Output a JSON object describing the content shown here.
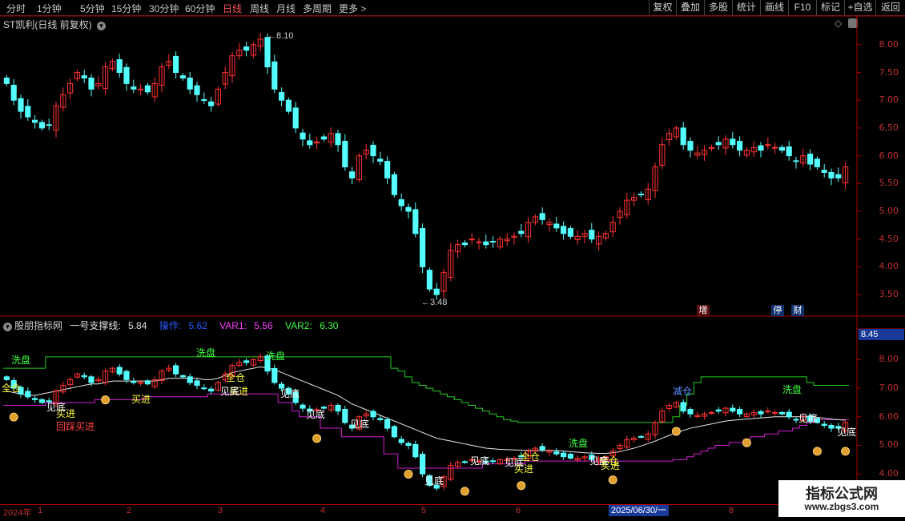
{
  "toolbar": {
    "periods": [
      "分时",
      "1分钟",
      "5分钟",
      "15分钟",
      "30分钟",
      "60分钟",
      "日线",
      "周线",
      "月线",
      "多周期",
      "更多 >"
    ],
    "active_period": "日线",
    "buttons": [
      "复权",
      "叠加",
      "多股",
      "统计",
      "画线",
      "F10",
      "标记",
      "+自选",
      "返回"
    ]
  },
  "main_chart": {
    "title": "ST凯利(日线 前复权)",
    "high_label": "8.10",
    "low_label": "3.48",
    "y_ticks": [
      "8.00",
      "7.50",
      "7.00",
      "6.50",
      "6.00",
      "5.50",
      "5.00",
      "4.50",
      "4.00",
      "3.50"
    ],
    "events": [
      {
        "text": "增",
        "color": "#c02020"
      },
      {
        "text": "停",
        "color": "#2060c0"
      },
      {
        "text": "财",
        "color": "#2060c0"
      }
    ]
  },
  "indicator": {
    "name": "股朋指标网",
    "fields": [
      {
        "label": "一号支撑线:",
        "value": "5.84",
        "color": "#e0e0e0"
      },
      {
        "label": "操作:",
        "value": "5.62",
        "color": "#2a5cff"
      },
      {
        "label": "VAR1:",
        "value": "5.56",
        "color": "#ff40ff"
      },
      {
        "label": "VAR2:",
        "value": "6.30",
        "color": "#40ff40"
      }
    ],
    "current_price": "8.45",
    "y_ticks": [
      "8.00",
      "7.00",
      "6.00",
      "5.00",
      "4.00"
    ],
    "signals": {
      "wash": "洗盘",
      "full": "全仓",
      "reduce": "减仓",
      "buy": "买进",
      "bottom": "见底",
      "pullback_buy": "回踩买进"
    }
  },
  "time_axis": {
    "labels": [
      "2024年",
      "1",
      "2",
      "3",
      "4",
      "5",
      "6",
      "2025/06/30/一",
      "8"
    ],
    "cursor_date": "2025/06/30/一"
  },
  "watermark": {
    "title": "指标公式网",
    "url": "www.zbgs3.com"
  },
  "chart_data": {
    "type": "candlestick",
    "ylim_main": [
      3.3,
      8.3
    ],
    "ylim_indicator": [
      3.5,
      8.6
    ],
    "closes": [
      7.3,
      7.0,
      6.8,
      6.7,
      6.6,
      6.5,
      6.55,
      6.9,
      7.1,
      7.3,
      7.5,
      7.4,
      7.2,
      7.3,
      7.6,
      7.7,
      7.5,
      7.3,
      7.2,
      7.2,
      7.15,
      7.3,
      7.6,
      7.7,
      7.5,
      7.4,
      7.2,
      7.1,
      7.0,
      6.9,
      7.2,
      7.5,
      7.8,
      7.9,
      7.9,
      8.0,
      8.1,
      7.6,
      7.2,
      7.0,
      6.8,
      6.5,
      6.3,
      6.2,
      6.25,
      6.3,
      6.4,
      6.2,
      5.8,
      5.6,
      6.0,
      6.1,
      6.0,
      5.9,
      5.6,
      5.3,
      5.1,
      5.0,
      4.6,
      4.0,
      3.6,
      3.5,
      3.9,
      4.3,
      4.4,
      4.4,
      4.5,
      4.45,
      4.4,
      4.45,
      4.5,
      4.5,
      4.55,
      4.6,
      4.8,
      4.9,
      4.85,
      4.8,
      4.7,
      4.6,
      4.55,
      4.55,
      4.6,
      4.5,
      4.55,
      4.6,
      4.8,
      5.0,
      5.2,
      5.25,
      5.3,
      5.4,
      5.8,
      6.2,
      6.4,
      6.5,
      6.2,
      6.1,
      6.05,
      6.1,
      6.15,
      6.2,
      6.3,
      6.2,
      6.1,
      6.1,
      6.15,
      6.1,
      6.2,
      6.15,
      6.1,
      6.0,
      5.9,
      6.0,
      5.85,
      5.8,
      5.7,
      5.6,
      5.6,
      5.8
    ],
    "support_line": [
      6.9,
      6.9,
      6.9,
      6.9,
      6.9,
      6.9,
      7.3,
      7.3,
      7.3,
      7.3,
      7.3,
      7.3,
      7.3,
      7.3,
      7.3,
      7.3,
      7.3,
      7.3,
      7.3,
      7.3,
      7.3,
      7.3,
      7.3,
      7.3,
      7.3,
      7.3,
      7.3,
      7.3,
      7.3,
      7.3,
      7.3,
      7.3,
      7.3,
      7.3,
      7.3,
      7.3,
      7.3,
      7.3,
      7.3,
      7.3,
      7.3,
      7.3,
      7.3,
      7.3,
      7.3,
      7.3,
      7.3,
      7.3,
      7.3,
      7.3,
      7.3,
      7.3,
      7.3,
      7.3,
      7.3,
      6.9,
      6.8,
      6.6,
      6.4,
      6.3,
      6.2,
      6.1,
      6.0,
      5.9,
      5.8,
      5.7,
      5.6,
      5.5,
      5.4,
      5.3,
      5.2,
      5.1,
      5.05,
      5.0,
      5.0,
      5.0,
      5.0,
      5.0,
      5.0,
      5.0,
      5.0,
      5.0,
      5.0,
      5.0,
      5.0,
      5.0,
      5.0,
      5.0,
      5.0,
      5.0,
      5.0,
      5.0,
      5.0,
      5.0,
      5.0,
      5.2,
      5.6,
      6.0,
      6.4,
      6.6,
      6.6,
      6.6,
      6.6,
      6.6,
      6.6,
      6.6,
      6.6,
      6.6,
      6.6,
      6.6,
      6.6,
      6.6,
      6.6,
      6.6,
      6.4,
      6.3,
      6.3,
      6.3,
      6.3,
      6.3
    ],
    "trend_line": [
      6.9,
      6.85,
      6.8,
      6.75,
      6.75,
      6.8,
      6.85,
      6.9,
      6.95,
      7.0,
      7.05,
      7.1,
      7.15,
      7.15,
      7.2,
      7.25,
      7.25,
      7.25,
      7.25,
      7.25,
      7.25,
      7.25,
      7.3,
      7.35,
      7.35,
      7.35,
      7.35,
      7.35,
      7.3,
      7.3,
      7.35,
      7.45,
      7.55,
      7.6,
      7.65,
      7.7,
      7.75,
      7.7,
      7.65,
      7.55,
      7.45,
      7.35,
      7.25,
      7.15,
      7.05,
      6.95,
      6.85,
      6.75,
      6.6,
      6.45,
      6.35,
      6.25,
      6.15,
      6.05,
      5.95,
      5.85,
      5.75,
      5.65,
      5.55,
      5.45,
      5.35,
      5.25,
      5.2,
      5.15,
      5.1,
      5.05,
      5.0,
      4.95,
      4.9,
      4.88,
      4.86,
      4.85,
      4.84,
      4.83,
      4.82,
      4.82,
      4.82,
      4.82,
      4.82,
      4.8,
      4.78,
      4.76,
      4.74,
      4.73,
      4.72,
      4.72,
      4.74,
      4.78,
      4.84,
      4.9,
      4.98,
      5.06,
      5.15,
      5.25,
      5.35,
      5.45,
      5.52,
      5.6,
      5.65,
      5.7,
      5.75,
      5.8,
      5.85,
      5.88,
      5.9,
      5.92,
      5.94,
      5.96,
      5.98,
      6.0,
      6.0,
      6.0,
      6.0,
      6.0,
      6.0,
      5.98,
      5.95,
      5.92,
      5.9,
      5.88
    ],
    "var1_line": [
      6.4,
      6.4,
      6.4,
      6.4,
      6.4,
      6.4,
      6.5,
      6.5,
      6.5,
      6.5,
      6.5,
      6.5,
      6.5,
      6.6,
      6.6,
      6.6,
      6.6,
      6.6,
      6.6,
      6.6,
      6.7,
      6.7,
      6.7,
      6.7,
      6.7,
      6.7,
      6.7,
      6.7,
      6.7,
      6.8,
      6.8,
      6.8,
      6.8,
      6.8,
      6.8,
      6.8,
      6.8,
      6.8,
      6.8,
      6.5,
      6.5,
      6.2,
      6.0,
      6.0,
      6.0,
      5.6,
      5.6,
      5.6,
      5.3,
      5.3,
      5.3,
      5.3,
      5.3,
      5.3,
      4.7,
      4.7,
      4.2,
      4.2,
      4.2,
      4.2,
      4.2,
      4.2,
      4.2,
      4.2,
      4.2,
      4.2,
      4.2,
      4.2,
      4.35,
      4.35,
      4.35,
      4.35,
      4.35,
      4.35,
      4.45,
      4.45,
      4.45,
      4.45,
      4.45,
      4.45,
      4.45,
      4.45,
      4.45,
      4.45,
      4.45,
      4.45,
      4.45,
      4.45,
      4.45,
      4.45,
      4.45,
      4.45,
      4.45,
      4.45,
      4.45,
      4.5,
      4.5,
      4.6,
      4.7,
      4.8,
      4.9,
      5.0,
      5.0,
      5.1,
      5.1,
      5.2,
      5.3,
      5.3,
      5.4,
      5.4,
      5.5,
      5.5,
      5.6,
      5.7,
      5.8,
      5.9,
      5.9,
      5.9,
      5.9,
      5.9
    ]
  }
}
